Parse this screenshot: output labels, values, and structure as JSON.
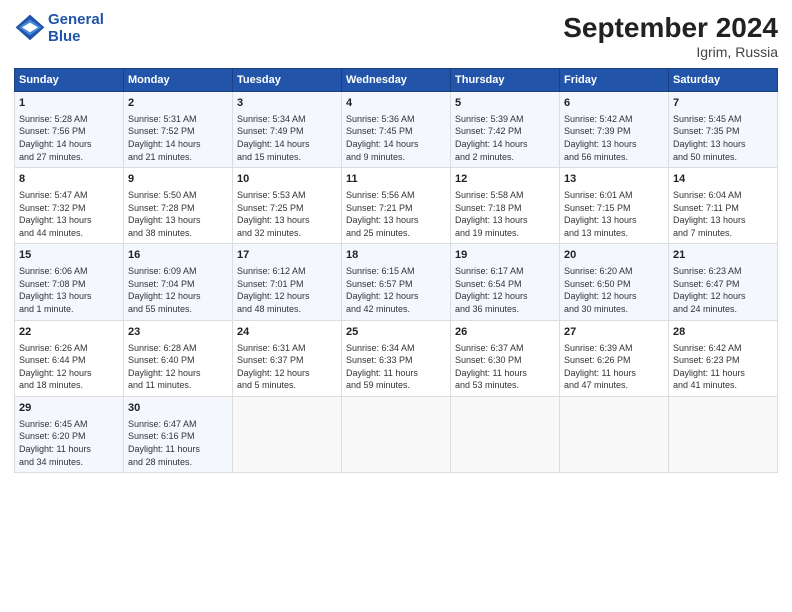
{
  "header": {
    "logo_line1": "General",
    "logo_line2": "Blue",
    "month_year": "September 2024",
    "location": "Igrim, Russia"
  },
  "days_of_week": [
    "Sunday",
    "Monday",
    "Tuesday",
    "Wednesday",
    "Thursday",
    "Friday",
    "Saturday"
  ],
  "weeks": [
    [
      {
        "day": "1",
        "info": "Sunrise: 5:28 AM\nSunset: 7:56 PM\nDaylight: 14 hours\nand 27 minutes."
      },
      {
        "day": "2",
        "info": "Sunrise: 5:31 AM\nSunset: 7:52 PM\nDaylight: 14 hours\nand 21 minutes."
      },
      {
        "day": "3",
        "info": "Sunrise: 5:34 AM\nSunset: 7:49 PM\nDaylight: 14 hours\nand 15 minutes."
      },
      {
        "day": "4",
        "info": "Sunrise: 5:36 AM\nSunset: 7:45 PM\nDaylight: 14 hours\nand 9 minutes."
      },
      {
        "day": "5",
        "info": "Sunrise: 5:39 AM\nSunset: 7:42 PM\nDaylight: 14 hours\nand 2 minutes."
      },
      {
        "day": "6",
        "info": "Sunrise: 5:42 AM\nSunset: 7:39 PM\nDaylight: 13 hours\nand 56 minutes."
      },
      {
        "day": "7",
        "info": "Sunrise: 5:45 AM\nSunset: 7:35 PM\nDaylight: 13 hours\nand 50 minutes."
      }
    ],
    [
      {
        "day": "8",
        "info": "Sunrise: 5:47 AM\nSunset: 7:32 PM\nDaylight: 13 hours\nand 44 minutes."
      },
      {
        "day": "9",
        "info": "Sunrise: 5:50 AM\nSunset: 7:28 PM\nDaylight: 13 hours\nand 38 minutes."
      },
      {
        "day": "10",
        "info": "Sunrise: 5:53 AM\nSunset: 7:25 PM\nDaylight: 13 hours\nand 32 minutes."
      },
      {
        "day": "11",
        "info": "Sunrise: 5:56 AM\nSunset: 7:21 PM\nDaylight: 13 hours\nand 25 minutes."
      },
      {
        "day": "12",
        "info": "Sunrise: 5:58 AM\nSunset: 7:18 PM\nDaylight: 13 hours\nand 19 minutes."
      },
      {
        "day": "13",
        "info": "Sunrise: 6:01 AM\nSunset: 7:15 PM\nDaylight: 13 hours\nand 13 minutes."
      },
      {
        "day": "14",
        "info": "Sunrise: 6:04 AM\nSunset: 7:11 PM\nDaylight: 13 hours\nand 7 minutes."
      }
    ],
    [
      {
        "day": "15",
        "info": "Sunrise: 6:06 AM\nSunset: 7:08 PM\nDaylight: 13 hours\nand 1 minute."
      },
      {
        "day": "16",
        "info": "Sunrise: 6:09 AM\nSunset: 7:04 PM\nDaylight: 12 hours\nand 55 minutes."
      },
      {
        "day": "17",
        "info": "Sunrise: 6:12 AM\nSunset: 7:01 PM\nDaylight: 12 hours\nand 48 minutes."
      },
      {
        "day": "18",
        "info": "Sunrise: 6:15 AM\nSunset: 6:57 PM\nDaylight: 12 hours\nand 42 minutes."
      },
      {
        "day": "19",
        "info": "Sunrise: 6:17 AM\nSunset: 6:54 PM\nDaylight: 12 hours\nand 36 minutes."
      },
      {
        "day": "20",
        "info": "Sunrise: 6:20 AM\nSunset: 6:50 PM\nDaylight: 12 hours\nand 30 minutes."
      },
      {
        "day": "21",
        "info": "Sunrise: 6:23 AM\nSunset: 6:47 PM\nDaylight: 12 hours\nand 24 minutes."
      }
    ],
    [
      {
        "day": "22",
        "info": "Sunrise: 6:26 AM\nSunset: 6:44 PM\nDaylight: 12 hours\nand 18 minutes."
      },
      {
        "day": "23",
        "info": "Sunrise: 6:28 AM\nSunset: 6:40 PM\nDaylight: 12 hours\nand 11 minutes."
      },
      {
        "day": "24",
        "info": "Sunrise: 6:31 AM\nSunset: 6:37 PM\nDaylight: 12 hours\nand 5 minutes."
      },
      {
        "day": "25",
        "info": "Sunrise: 6:34 AM\nSunset: 6:33 PM\nDaylight: 11 hours\nand 59 minutes."
      },
      {
        "day": "26",
        "info": "Sunrise: 6:37 AM\nSunset: 6:30 PM\nDaylight: 11 hours\nand 53 minutes."
      },
      {
        "day": "27",
        "info": "Sunrise: 6:39 AM\nSunset: 6:26 PM\nDaylight: 11 hours\nand 47 minutes."
      },
      {
        "day": "28",
        "info": "Sunrise: 6:42 AM\nSunset: 6:23 PM\nDaylight: 11 hours\nand 41 minutes."
      }
    ],
    [
      {
        "day": "29",
        "info": "Sunrise: 6:45 AM\nSunset: 6:20 PM\nDaylight: 11 hours\nand 34 minutes."
      },
      {
        "day": "30",
        "info": "Sunrise: 6:47 AM\nSunset: 6:16 PM\nDaylight: 11 hours\nand 28 minutes."
      },
      {
        "day": "",
        "info": ""
      },
      {
        "day": "",
        "info": ""
      },
      {
        "day": "",
        "info": ""
      },
      {
        "day": "",
        "info": ""
      },
      {
        "day": "",
        "info": ""
      }
    ]
  ]
}
